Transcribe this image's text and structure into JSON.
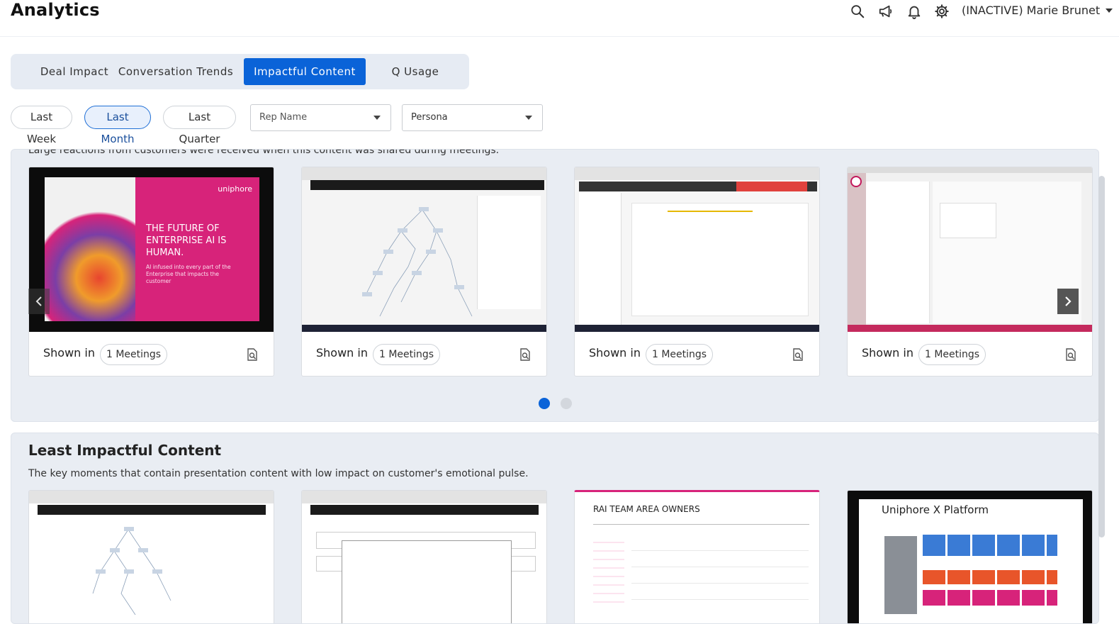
{
  "header": {
    "title": "Analytics",
    "user_label": "(INACTIVE) Marie Brunet",
    "icons": [
      "search-icon",
      "megaphone-icon",
      "bell-icon",
      "gear-icon"
    ]
  },
  "tabs": [
    {
      "label": "Deal Impact",
      "active": false
    },
    {
      "label": "Conversation Trends",
      "active": false
    },
    {
      "label": "Impactful Content",
      "active": true
    },
    {
      "label": "Q Usage",
      "active": false
    }
  ],
  "filters": {
    "periods": [
      {
        "label": "Last Week",
        "active": false
      },
      {
        "label": "Last Month",
        "active": true
      },
      {
        "label": "Last Quarter",
        "active": false
      }
    ],
    "rep_name_placeholder": "Rep Name",
    "persona_placeholder": "Persona"
  },
  "most_impactful": {
    "description": "Large reactions from customers were received when this content was shared during meetings.",
    "cards": [
      {
        "shown_in": "Shown in",
        "meetings": "1 Meetings",
        "slide_brand": "uniphore",
        "slide_heading": "THE FUTURE OF ENTERPRISE AI IS HUMAN.",
        "slide_sub": "AI infused into every part of the Enterprise that impacts the customer"
      },
      {
        "shown_in": "Shown in",
        "meetings": "1 Meetings"
      },
      {
        "shown_in": "Shown in",
        "meetings": "1 Meetings"
      },
      {
        "shown_in": "Shown in",
        "meetings": "1 Meetings"
      }
    ],
    "pagination": {
      "pages": 2,
      "current": 1
    }
  },
  "least_impactful": {
    "title": "Least Impactful Content",
    "description": "The key moments that contain presentation content with low impact on customer's emotional pulse.",
    "slide3_title": "RAI TEAM AREA OWNERS",
    "slide4_title": "Uniphore X Platform"
  },
  "colors": {
    "accent": "#0a63d8",
    "section_bg": "#e9edf3",
    "magenta": "#d7237a"
  }
}
